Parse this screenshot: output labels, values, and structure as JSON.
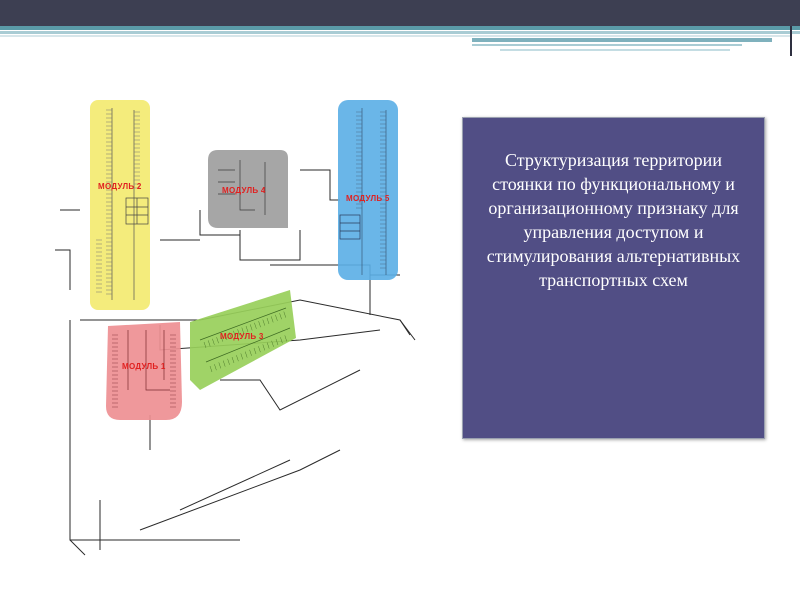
{
  "colors": {
    "top_bar": "#3d3f52",
    "stripe_teal": "#5a9aa7",
    "stripe_light": "#a9ccd4",
    "module_yellow": "#f3ea6e",
    "module_gray": "#9c9c9c",
    "module_blue": "#5aaee6",
    "module_green": "#98cf5a",
    "module_pink": "#ee8f93",
    "module_label": "#e02020",
    "textbox_bg": "#514e85",
    "textbox_text": "#ffffff"
  },
  "plan": {
    "modules": [
      {
        "label": "МОДУЛЬ 2"
      },
      {
        "label": "МОДУЛЬ 4"
      },
      {
        "label": "МОДУЛЬ 5"
      },
      {
        "label": "МОДУЛЬ 3"
      },
      {
        "label": "МОДУЛЬ 1"
      }
    ]
  },
  "textbox": {
    "text": "Структуризация территории стоянки по функциональному и организационному признаку для управления доступом и стимулирования альтернативных транспортных схем"
  }
}
